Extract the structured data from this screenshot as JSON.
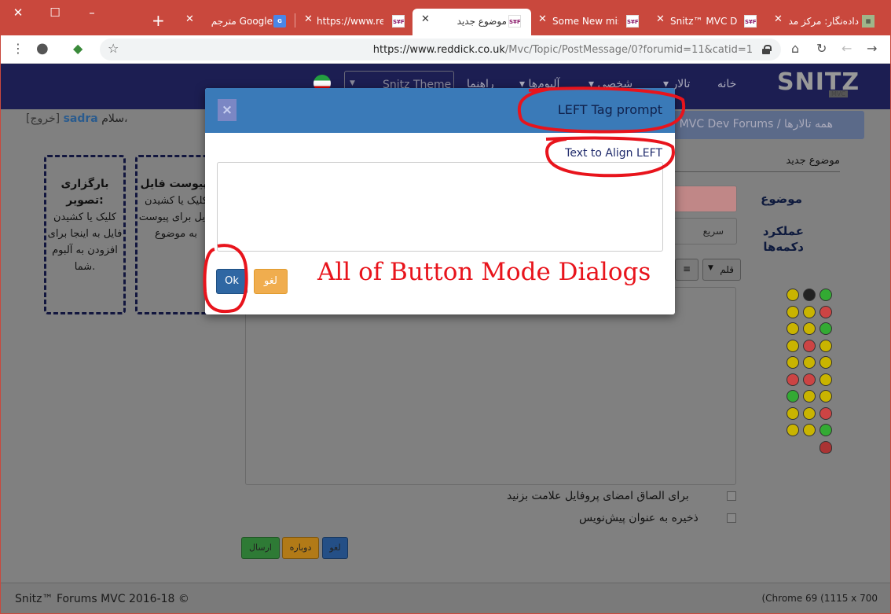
{
  "browser": {
    "tabs": [
      {
        "title": "دادەنگار: مرکز مد"
      },
      {
        "title": "Snitz™ MVC Dev"
      },
      {
        "title": "Some New miss"
      },
      {
        "title": "موضوع جدید"
      },
      {
        "title": "https://www.red"
      },
      {
        "title": "مترجم Google"
      }
    ],
    "url_host": "https://www.reddick.co.uk",
    "url_path": "/Mvc/Topic/PostMessage/0?forumid=11&catid=1"
  },
  "nav": {
    "home": "خانه",
    "forums": "تالار",
    "personal": "شخصی",
    "albums": "آلبوم‌ها",
    "help": "راهنما",
    "theme": "Snitz Theme",
    "logo": "SNITZ",
    "logo_sub": "MVC"
  },
  "greeting": {
    "hello": "سلام،",
    "user": "sadra",
    "logout": "[خروج]"
  },
  "breadcrumb": {
    "all": "همه تالارها",
    "sep": "/",
    "forum": "Snitz™ MVC Dev Forums"
  },
  "form": {
    "new_topic": "موضوع جدید",
    "subject_label": "موضوع",
    "buttons_label": "عملکرد دکمه‌ها",
    "quick_select": "سریع",
    "font_btn": "قلم",
    "signature_check": "برای الصاق امضای پروفایل علامت بزنید",
    "draft_check": "ذخیره به عنوان پیش‌نویس",
    "send": "ارسال",
    "preview": "دوباره",
    "cancel": "لغو"
  },
  "upload_image": {
    "title": "بارگزاری تصویر:",
    "text": "کلیک یا کشیدن فایل به اینجا برای افزودن به آلبوم شما."
  },
  "upload_file": {
    "title": "پیوست فایل:",
    "text": "کلیک یا کشیدن فایل برای پیوست به موضوع"
  },
  "modal": {
    "title": "LEFT Tag prompt",
    "label": "Text to Align LEFT",
    "textarea_value": "",
    "ok": "Ok",
    "cancel": "لغو",
    "close": "×"
  },
  "annotation": {
    "text": "All of Button Mode Dialogs",
    "color": "#e8141c"
  },
  "footer": {
    "left": "Snitz™ Forums MVC 2016-18 ©",
    "right": "(Chrome 69 (1115 x 700"
  },
  "colors": {
    "tabbar": "#c9483d",
    "modal_header": "#3a7ab8",
    "nav": "#1c1e52",
    "ok_button": "#2f67a3",
    "cancel_button": "#f0ad4e"
  }
}
